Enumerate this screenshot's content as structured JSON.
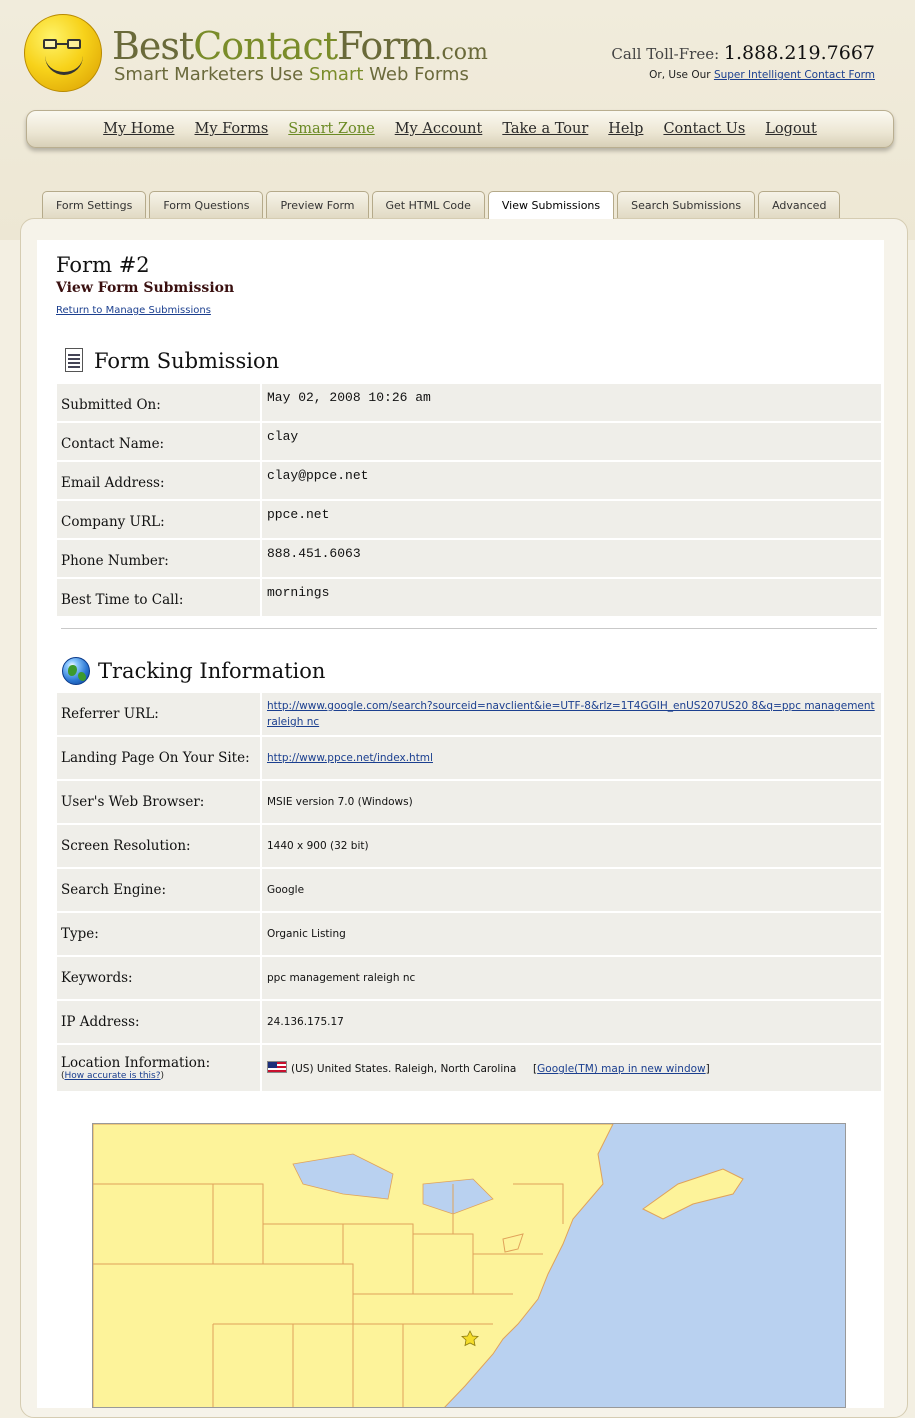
{
  "header": {
    "brand_best": "Best",
    "brand_contact": "Contact",
    "brand_form": "Form",
    "brand_com": ".com",
    "tagline_pre": "Smart Marketers Use ",
    "tagline_smart": "Smart",
    "tagline_post": " Web Forms",
    "tollfree_label": "Call Toll-Free:",
    "tollfree_number": "1.888.219.7667",
    "or_text": "Or, Use Our",
    "or_link": "Super Intelligent Contact Form"
  },
  "nav": [
    {
      "label": "My Home"
    },
    {
      "label": "My Forms"
    },
    {
      "label": "Smart Zone"
    },
    {
      "label": "My Account"
    },
    {
      "label": "Take a Tour"
    },
    {
      "label": "Help"
    },
    {
      "label": "Contact Us"
    },
    {
      "label": "Logout"
    }
  ],
  "tabs": [
    {
      "label": "Form Settings"
    },
    {
      "label": "Form Questions"
    },
    {
      "label": "Preview Form"
    },
    {
      "label": "Get HTML Code"
    },
    {
      "label": "View Submissions"
    },
    {
      "label": "Search Submissions"
    },
    {
      "label": "Advanced"
    }
  ],
  "page": {
    "form_title": "Form #2",
    "subtitle": "View Form Submission",
    "return_link": "Return to Manage Submissions"
  },
  "submission": {
    "heading": "Form Submission",
    "rows": [
      {
        "label": "Submitted On:",
        "value": "May 02, 2008 10:26 am"
      },
      {
        "label": "Contact Name:",
        "value": "clay"
      },
      {
        "label": "Email Address:",
        "value": "clay@ppce.net"
      },
      {
        "label": "Company URL:",
        "value": "ppce.net"
      },
      {
        "label": "Phone Number:",
        "value": "888.451.6063"
      },
      {
        "label": "Best Time to Call:",
        "value": "mornings"
      }
    ]
  },
  "tracking": {
    "heading": "Tracking Information",
    "referrer_label": "Referrer URL:",
    "referrer_value": "http://www.google.com/search?sourceid=navclient&ie=UTF-8&rlz=1T4GGIH_enUS207US20 8&q=ppc management raleigh nc",
    "landing_label": "Landing Page On Your Site:",
    "landing_value": "http://www.ppce.net/index.html",
    "browser_label": "User's Web Browser:",
    "browser_value": "MSIE version 7.0 (Windows)",
    "resolution_label": "Screen Resolution:",
    "resolution_value": "1440 x 900 (32 bit)",
    "engine_label": "Search Engine:",
    "engine_value": "Google",
    "type_label": "Type:",
    "type_value": "Organic Listing",
    "keywords_label": "Keywords:",
    "keywords_value": "ppc management raleigh nc",
    "ip_label": "IP Address:",
    "ip_value": "24.136.175.17",
    "location_label": "Location Information:",
    "location_help": "How accurate is this?",
    "location_value": "(US) United States. Raleigh, North Carolina",
    "map_link": "Google(TM) map in new window"
  },
  "colors": {
    "nav_active": "#6a8a24",
    "link": "#1b3f8f",
    "map_water": "#b9d1f0",
    "map_land": "#fdf39a",
    "map_border": "#e0a25a"
  },
  "map": {
    "marker_icon": "star-marker-icon"
  }
}
